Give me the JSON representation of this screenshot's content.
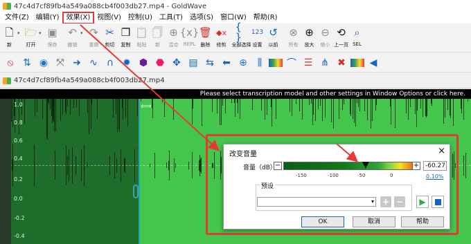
{
  "window": {
    "title": "47c4d7cf89fb4a549a088cb4f003db27.mp4 - GoldWave"
  },
  "menubar": {
    "items": [
      "文件(Z)",
      "编辑(Y)",
      "效果(X)",
      "视图(V)",
      "控制(U)",
      "工具(T)",
      "选项(S)",
      "窗口(W)",
      "帮助(R)"
    ]
  },
  "toolbar": {
    "buttons": [
      {
        "label": "新",
        "icon": "new-file-icon"
      },
      {
        "label": "打开",
        "icon": "open-folder-icon"
      },
      {
        "label": "保存",
        "icon": "save-disk-icon"
      },
      {
        "label": "撤销",
        "icon": "undo-icon"
      },
      {
        "label": "重做",
        "icon": "redo-icon"
      },
      {
        "label": "剪切",
        "icon": "scissors-icon"
      },
      {
        "label": "复制",
        "icon": "copy-icon"
      },
      {
        "label": "粘贴",
        "icon": "paste-icon"
      },
      {
        "label": "新",
        "icon": "paste-new-icon"
      },
      {
        "label": "混合",
        "icon": "mix-icon"
      },
      {
        "label": "REPL",
        "icon": "replace-icon"
      },
      {
        "label": "删除",
        "icon": "trash-icon"
      },
      {
        "label": "修剪",
        "icon": "trim-icon"
      },
      {
        "label": "全部选择",
        "icon": "select-all-icon"
      },
      {
        "label": "设置",
        "icon": "set-123-icon"
      },
      {
        "label": "以前",
        "icon": "previous-icon"
      },
      {
        "label": "所有",
        "icon": "zoom-all-icon"
      },
      {
        "label": "放大",
        "icon": "zoom-in-icon"
      },
      {
        "label": "缩小",
        "icon": "zoom-out-icon"
      },
      {
        "label": "上一页",
        "icon": "previous-page-icon"
      },
      {
        "label": "SEL",
        "icon": "zoom-selection-icon"
      }
    ]
  },
  "effects_toolbar": {
    "icons": [
      "stop-sign-icon",
      "bidirectional-arrows-icon",
      "globe-icon",
      "cross-curve-icon",
      "right-arrow-icon",
      "wave-icon",
      "magnet-icon",
      "star-burst-icon",
      "hexagon-icon",
      "rainbow-hexagon-icon",
      "four-arrows-icon",
      "chart-icon",
      "double-arrow-icon",
      "left-arrow-icon",
      "compass-icon",
      "sliders-icon",
      "color-bar-icon",
      "dome-icon",
      "stack-icon",
      "fork-icon",
      "x-arrows-icon",
      "color-slider-icon",
      "blue-marker-icon"
    ]
  },
  "document": {
    "title": "47c4d7cf89fb4a549a088cb4f003db27.mp4"
  },
  "waveform": {
    "message": "Please select transcription model and other settings in Window Options or click here.",
    "y_ticks": [
      "1.0",
      "0.8",
      "0.6",
      "0.4",
      "0.2",
      "0.0",
      "-0.2",
      "-0.4"
    ]
  },
  "dialog": {
    "title": "改变音量",
    "close": "×",
    "volume_label": "音量（dB）:",
    "minus": "−",
    "plus": "+",
    "volume_value": "-60.27",
    "volume_db": -60.27,
    "slider_min": -180,
    "slider_max": 18,
    "scale": [
      "-150",
      "-100",
      "-50",
      "0"
    ],
    "percent_link": "0.10%",
    "preset_label": "预设",
    "preset_value": "",
    "ok": "OK",
    "cancel": "取消",
    "help": "帮助"
  },
  "colors": {
    "annotation": "#e53935",
    "waveform_bg": "#43c64b",
    "waveform_selected": "#1f6d2b"
  }
}
